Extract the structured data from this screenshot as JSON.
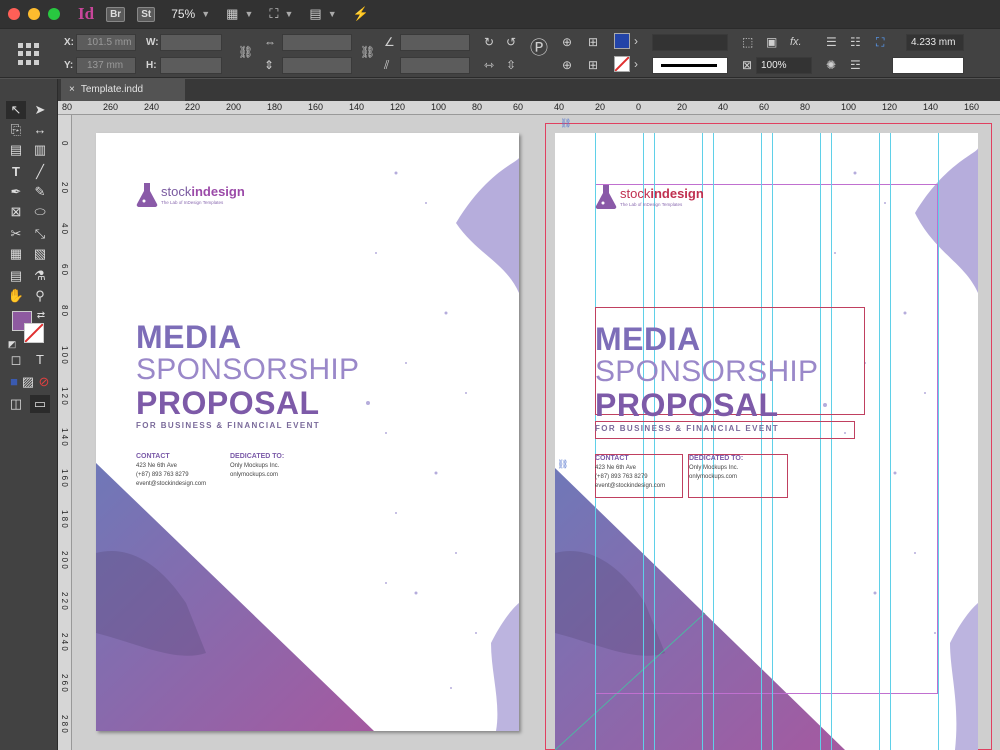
{
  "appbar": {
    "traffic_lights": [
      "#ff5f57",
      "#febc2e",
      "#28c840"
    ],
    "app_name": "Id",
    "chip_br": "Br",
    "chip_st": "St",
    "zoom": "75%"
  },
  "control": {
    "x_label": "X:",
    "x_value": "101.5 mm",
    "y_label": "Y:",
    "y_value": "137 mm",
    "w_label": "W:",
    "h_label": "H:",
    "fill_color": "#2344a8",
    "stroke_weight": "4.233 mm",
    "opacity": "100%",
    "fx_label": "fx."
  },
  "tabs": [
    {
      "label": "Template.indd"
    }
  ],
  "rulers": {
    "h_ticks": [
      "80",
      "260",
      "240",
      "220",
      "200",
      "180",
      "160",
      "140",
      "120",
      "100",
      "80",
      "60",
      "40",
      "20",
      "0",
      "20",
      "40",
      "60",
      "80",
      "100",
      "120",
      "140",
      "160"
    ],
    "v_ticks": [
      "0",
      "2 0",
      "4 0",
      "6 0",
      "8 0",
      "1 0 0",
      "1 2 0",
      "1 4 0",
      "1 6 0",
      "1 8 0",
      "2 0 0",
      "2 2 0",
      "2 4 0",
      "2 6 0",
      "2 8 0"
    ]
  },
  "document": {
    "logo_name_a": "stock",
    "logo_name_b": "indesign",
    "logo_tagline": "The Lab of InDesign Templates",
    "title_line1": "MEDIA",
    "title_line2": "SPONSORSHIP",
    "title_line3": "PROPOSAL",
    "subtitle": "For Business & Financial Event",
    "contact_heading": "CONTACT",
    "contact_address": "423 Ne 6th Ave",
    "contact_phone": "(+87) 893 763 8279",
    "contact_email": "event@stockindesign.com",
    "dedicated_heading": "DEDICATED TO:",
    "dedicated_name": "Only Mockups Inc.",
    "dedicated_site": "onlymockups.com"
  },
  "colors": {
    "accent_purple": "#7d6db8",
    "guide_cyan": "#5fd0e8",
    "frame_red": "#c04060",
    "stroke_black": "#000000"
  }
}
